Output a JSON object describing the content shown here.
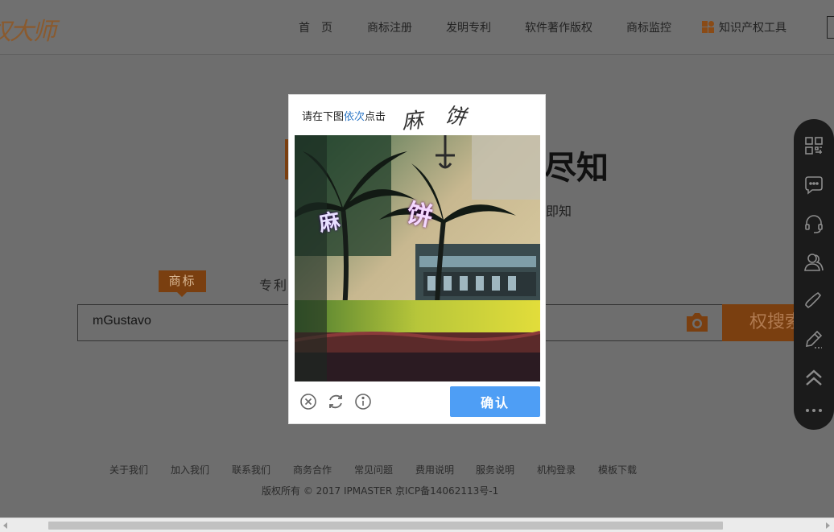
{
  "header": {
    "logo_text": "权大师",
    "nav": [
      "首　页",
      "商标注册",
      "发明专利",
      "软件著作版权",
      "商标监控",
      "知识产权工具"
    ]
  },
  "hero": {
    "title_visible": "尽知",
    "subtitle_visible": "即知"
  },
  "search": {
    "tabs": [
      "商标",
      "专利"
    ],
    "input_value": "mGustavo",
    "button_label": "权搜索",
    "camera_icon": "camera-icon"
  },
  "footer": {
    "links": [
      "关于我们",
      "加入我们",
      "联系我们",
      "商务合作",
      "常见问题",
      "费用说明",
      "服务说明",
      "机构登录",
      "模板下载"
    ],
    "copyright": "版权所有 © 2017 IPMASTER 京ICP备14062113号-1"
  },
  "sidebar": {
    "icons": [
      "qrcode-icon",
      "chat-icon",
      "headset-icon",
      "users-icon",
      "phone-icon",
      "edit-icon",
      "back-to-top-icon",
      "more-icon"
    ]
  },
  "captcha": {
    "prompt_before": "请在下图",
    "prompt_highlight": "依次",
    "prompt_after": "点击",
    "target_chars": [
      "麻",
      "饼"
    ],
    "image_labels": [
      "麻",
      "饼"
    ],
    "confirm_label": "确认",
    "controls": [
      "close-icon",
      "refresh-icon",
      "info-icon"
    ],
    "highlight_color": "#2e78c7",
    "button_color": "#4e9ef5"
  },
  "colors": {
    "brand": "#7a3f10",
    "overlay": "#6e6e6e"
  }
}
